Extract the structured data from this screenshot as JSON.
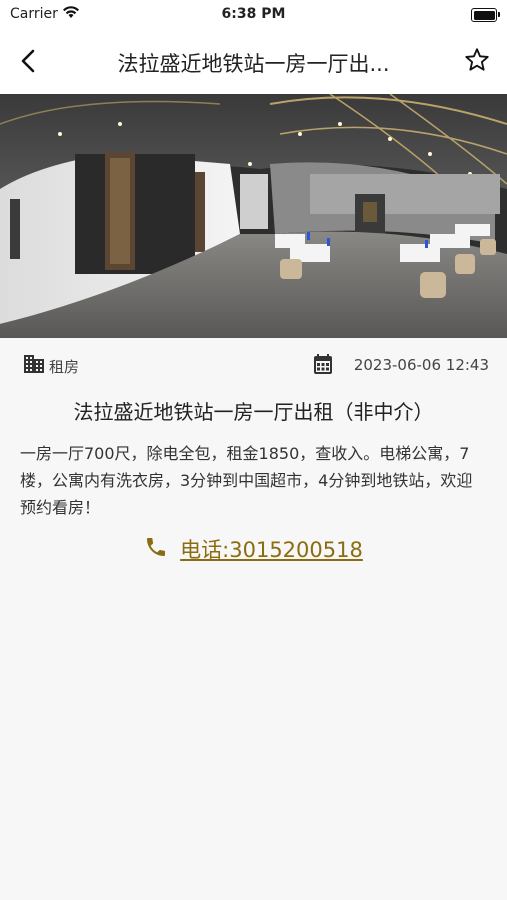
{
  "status_bar": {
    "carrier": "Carrier",
    "time": "6:38 PM"
  },
  "nav": {
    "title": "法拉盛近地铁站一房一厅出...",
    "back_icon": "chevron-left-icon",
    "favorite_icon": "star-outline-icon"
  },
  "listing": {
    "category": "租房",
    "category_icon": "building-icon",
    "datetime": "2023-06-06 12:43",
    "datetime_icon": "calendar-icon",
    "title": "法拉盛近地铁站一房一厅出租（非中介）",
    "description": "一房一厅700尺，除电全包，租金1850，查收入。电梯公寓，7楼，公寓内有洗衣房，3分钟到中国超市，4分钟到地铁站，欢迎预约看房！",
    "phone": "电话:3015200518",
    "phone_icon": "phone-icon"
  },
  "colors": {
    "accent": "#8a6d10",
    "background": "#f7f7f7"
  }
}
